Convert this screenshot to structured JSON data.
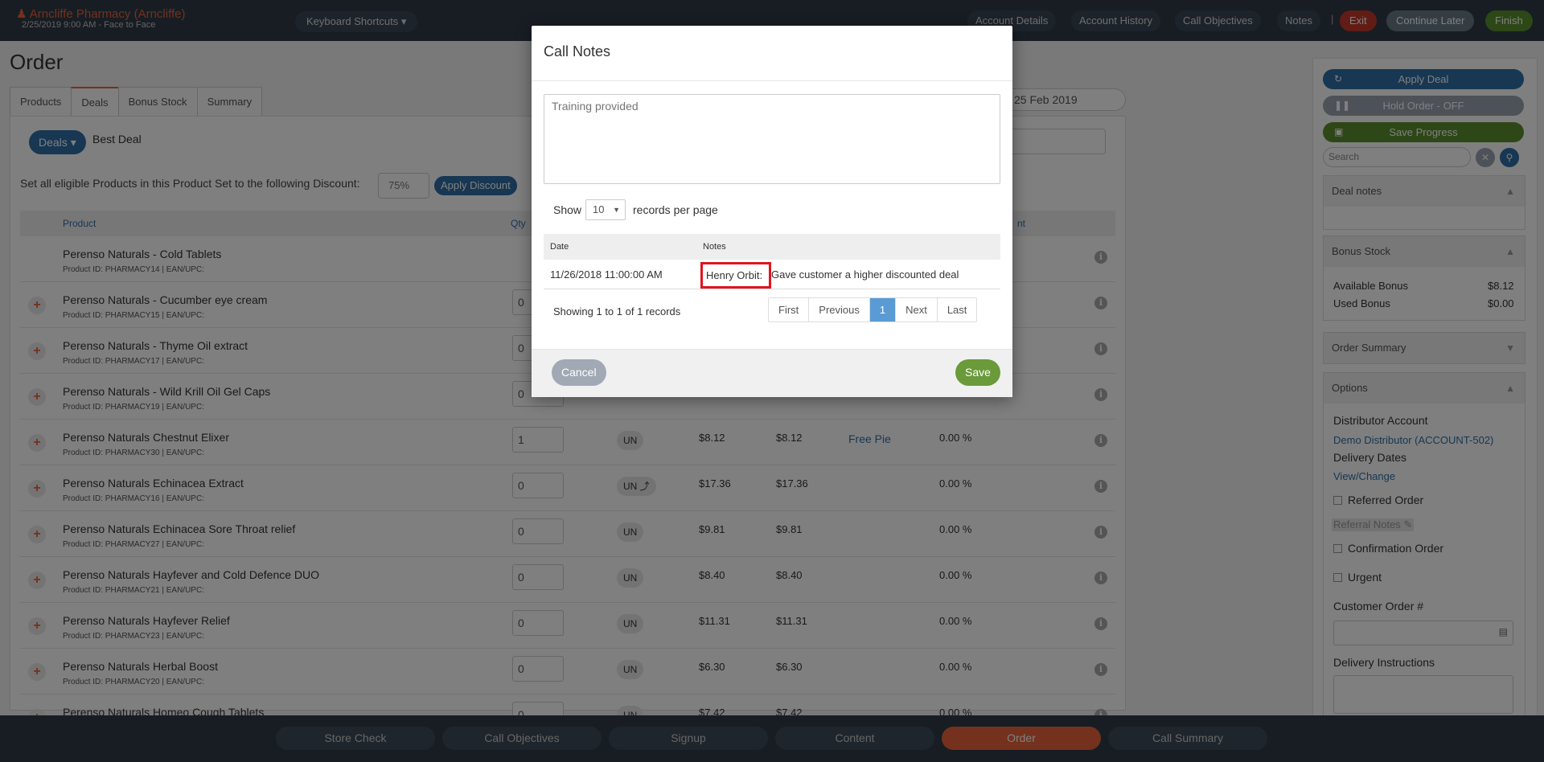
{
  "topbar": {
    "account_name": "Arncliffe Pharmacy (Arncliffe)",
    "account_sub": "2/25/2019 9:00 AM - Face to Face",
    "keyboard_shortcuts": "Keyboard Shortcuts",
    "nav": [
      "Account Details",
      "Account History",
      "Call Objectives",
      "Notes"
    ],
    "separator": "|",
    "exit": "Exit",
    "continue_later": "Continue Later",
    "finish": "Finish",
    "colors": {
      "bar": "#2e3a47",
      "exit": "#c0392b",
      "continue": "#6b7a89",
      "finish": "#5b8f2e"
    }
  },
  "main": {
    "title": "Order",
    "tabs": [
      "Products",
      "Deals",
      "Bonus Stock",
      "Summary"
    ],
    "active_tab": "Deals",
    "date_value": "25 Feb 2019",
    "deals_button": "Deals",
    "best_deal": "Best Deal",
    "set_all_text": "Set all eligible Products in this Product Set to the following Discount:",
    "discount_value": "75%",
    "apply_discount": "Apply Discount",
    "columns": {
      "product": "Product",
      "qty": "Qty",
      "discount": "nt"
    },
    "rows": [
      {
        "name": "Perenso Naturals - Cold Tablets",
        "pid": "Product ID: PHARMACY14 | EAN/UPC:",
        "qty": "",
        "unit": "",
        "p1": "",
        "p2": "",
        "deal": "",
        "pct": ""
      },
      {
        "name": "Perenso Naturals - Cucumber eye cream",
        "pid": "Product ID: PHARMACY15 | EAN/UPC:",
        "qty": "0",
        "unit": "",
        "p1": "",
        "p2": "",
        "deal": "",
        "pct": ""
      },
      {
        "name": "Perenso Naturals - Thyme Oil extract",
        "pid": "Product ID: PHARMACY17 | EAN/UPC:",
        "qty": "0",
        "unit": "",
        "p1": "",
        "p2": "",
        "deal": "",
        "pct": ""
      },
      {
        "name": "Perenso Naturals - Wild Krill Oil Gel Caps",
        "pid": "Product ID: PHARMACY19 | EAN/UPC:",
        "qty": "0",
        "unit": "",
        "p1": "",
        "p2": "",
        "deal": "",
        "pct": ""
      },
      {
        "name": "Perenso Naturals Chestnut Elixer",
        "pid": "Product ID: PHARMACY30 | EAN/UPC:",
        "qty": "1",
        "unit": "UN",
        "p1": "$8.12",
        "p2": "$8.12",
        "deal": "Free Pie",
        "pct": "0.00 %"
      },
      {
        "name": "Perenso Naturals Echinacea Extract",
        "pid": "Product ID: PHARMACY16 | EAN/UPC:",
        "qty": "0",
        "unit": "UN ⤴",
        "p1": "$17.36",
        "p2": "$17.36",
        "deal": "",
        "pct": "0.00 %"
      },
      {
        "name": "Perenso Naturals Echinacea Sore Throat relief",
        "pid": "Product ID: PHARMACY27 | EAN/UPC:",
        "qty": "0",
        "unit": "UN",
        "p1": "$9.81",
        "p2": "$9.81",
        "deal": "",
        "pct": "0.00 %"
      },
      {
        "name": "Perenso Naturals Hayfever and Cold Defence DUO",
        "pid": "Product ID: PHARMACY21 | EAN/UPC:",
        "qty": "0",
        "unit": "UN",
        "p1": "$8.40",
        "p2": "$8.40",
        "deal": "",
        "pct": "0.00 %"
      },
      {
        "name": "Perenso Naturals Hayfever Relief",
        "pid": "Product ID: PHARMACY23 | EAN/UPC:",
        "qty": "0",
        "unit": "UN",
        "p1": "$11.31",
        "p2": "$11.31",
        "deal": "",
        "pct": "0.00 %"
      },
      {
        "name": "Perenso Naturals Herbal Boost",
        "pid": "Product ID: PHARMACY20 | EAN/UPC:",
        "qty": "0",
        "unit": "UN",
        "p1": "$6.30",
        "p2": "$6.30",
        "deal": "",
        "pct": "0.00 %"
      },
      {
        "name": "Perenso Naturals Homeo Cough Tablets",
        "pid": "",
        "qty": "0",
        "unit": "UN",
        "p1": "$7.42",
        "p2": "$7.42",
        "deal": "",
        "pct": "0.00 %"
      }
    ]
  },
  "sidebar": {
    "apply_deal": "Apply Deal",
    "hold_order": "Hold Order - OFF",
    "save_progress": "Save Progress",
    "search_placeholder": "Search",
    "deal_notes": "Deal notes",
    "bonus_stock": "Bonus Stock",
    "available_bonus_label": "Available Bonus",
    "available_bonus_value": "$8.12",
    "used_bonus_label": "Used Bonus",
    "used_bonus_value": "$0.00",
    "order_summary": "Order Summary",
    "options": "Options",
    "distributor_account_label": "Distributor Account",
    "distributor_account_value": "Demo Distributor (ACCOUNT-502)",
    "delivery_dates_label": "Delivery Dates",
    "delivery_dates_link": "View/Change",
    "referred_order": "Referred Order",
    "referral_notes": "Referral Notes",
    "confirmation_order": "Confirmation Order",
    "urgent": "Urgent",
    "customer_order_label": "Customer Order #",
    "delivery_instructions_label": "Delivery Instructions"
  },
  "bottombar": {
    "items": [
      "Store Check",
      "Call Objectives",
      "Signup",
      "Content",
      "Order",
      "Call Summary"
    ],
    "active": "Order"
  },
  "modal": {
    "title": "Call Notes",
    "textarea_placeholder": "Training provided",
    "show_label": "Show",
    "records_per_page": "10",
    "records_per_page_label": "records per page",
    "col_date": "Date",
    "col_notes": "Notes",
    "rows": [
      {
        "date": "11/26/2018 11:00:00 AM",
        "author": "Henry Orbit:",
        "note": "Gave customer a higher discounted deal"
      }
    ],
    "showing": "Showing 1 to 1 of 1 records",
    "pager": {
      "first": "First",
      "previous": "Previous",
      "current": "1",
      "next": "Next",
      "last": "Last"
    },
    "cancel": "Cancel",
    "save": "Save"
  }
}
